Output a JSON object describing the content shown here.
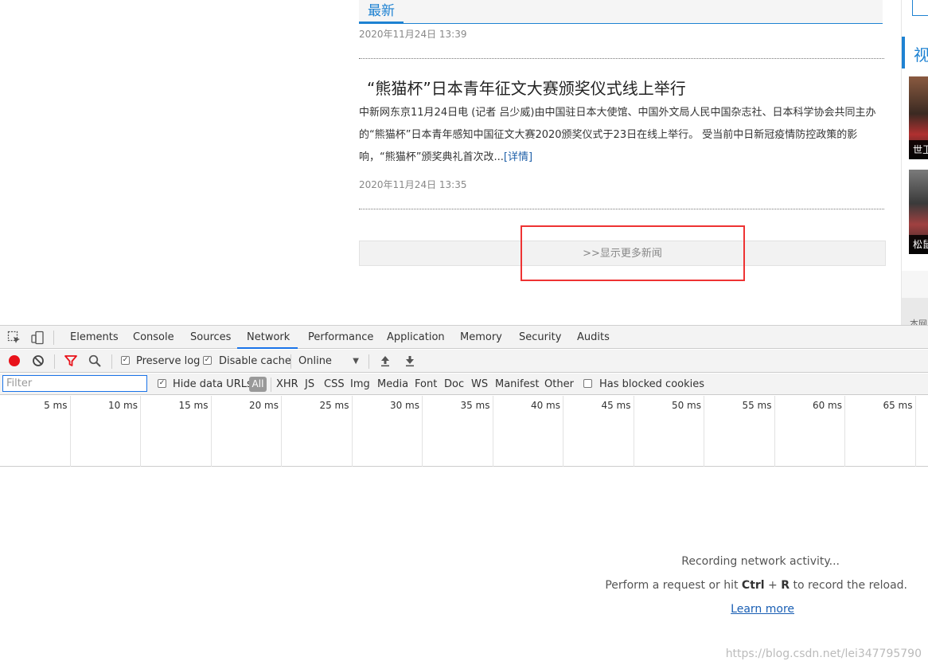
{
  "page": {
    "tab_latest": "最新",
    "date_prev": "2020年11月24日 13:39",
    "headline": "“熊猫杯”日本青年征文大赛颁奖仪式线上举行",
    "summary": "中新网东京11月24日电 (记者 吕少威)由中国驻日本大使馆、中国外文局人民中国杂志社、日本科学协会共同主办的“熊猫杯”日本青年感知中国征文大赛2020颁奖仪式于23日在线上举行。 受当前中日新冠疫情防控政策的影响，“熊猫杯”颁奖典礼首次改...",
    "details_link": "[详情]",
    "date": "2020年11月24日 13:35",
    "load_more": ">>显示更多新闻",
    "side_section_title": "视",
    "side_thumb1_caption": "世卫",
    "side_thumb2_caption": "松鼠",
    "side_footer": "本网"
  },
  "devtools": {
    "tabs": [
      "Elements",
      "Console",
      "Sources",
      "Network",
      "Performance",
      "Application",
      "Memory",
      "Security",
      "Audits"
    ],
    "active_tab": "Network",
    "toolbar": {
      "preserve_log": "Preserve log",
      "preserve_log_checked": true,
      "disable_cache": "Disable cache",
      "disable_cache_checked": true,
      "throttle": "Online"
    },
    "filter": {
      "placeholder": "Filter",
      "hide_data_urls": "Hide data URLs",
      "hide_data_urls_checked": true,
      "types": [
        "All",
        "XHR",
        "JS",
        "CSS",
        "Img",
        "Media",
        "Font",
        "Doc",
        "WS",
        "Manifest",
        "Other"
      ],
      "active_type": "All",
      "has_blocked_cookies": "Has blocked cookies",
      "has_blocked_cookies_checked": false
    },
    "timeline_ticks": [
      "5 ms",
      "10 ms",
      "15 ms",
      "20 ms",
      "25 ms",
      "30 ms",
      "35 ms",
      "40 ms",
      "45 ms",
      "50 ms",
      "55 ms",
      "60 ms",
      "65 ms"
    ],
    "empty": {
      "recording": "Recording network activity...",
      "hint_before": "Perform a request or hit ",
      "hint_key1": "Ctrl",
      "hint_plus": " + ",
      "hint_key2": "R",
      "hint_after": " to record the reload.",
      "learn_more": "Learn more"
    },
    "watermark": "https://blog.csdn.net/lei347795790"
  },
  "colors": {
    "accent_blue": "#1e82d2",
    "record_red": "#e8121a",
    "annotation_red": "#ee3333",
    "devtools_active_tab": "#1a73e8"
  }
}
